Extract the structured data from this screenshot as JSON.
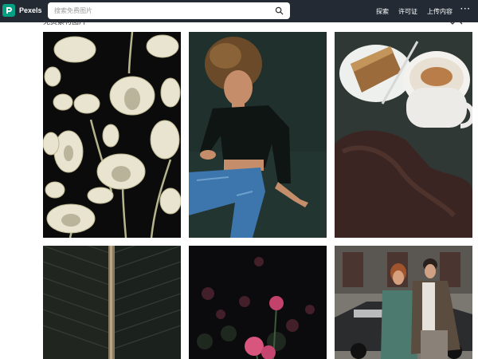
{
  "header": {
    "logo_letter": "P",
    "brand": "Pexels",
    "search": {
      "placeholder": "搜索免费图片"
    },
    "nav": {
      "explore": "探索",
      "license": "许可证",
      "upload": "上传内容",
      "more": "···"
    }
  },
  "gallery": {
    "section_title": "免费素材图片",
    "photos": [
      {
        "alt": "white tulips on black background"
      },
      {
        "alt": "woman in black top and jeans on floor"
      },
      {
        "alt": "cake, coffee and leather gloves"
      },
      {
        "alt": "dark leaf close-up"
      },
      {
        "alt": "pink flowers on dark background"
      },
      {
        "alt": "couple in front of vintage car"
      }
    ]
  },
  "colors": {
    "header_bg": "#232a34",
    "brand_green": "#05a081"
  }
}
